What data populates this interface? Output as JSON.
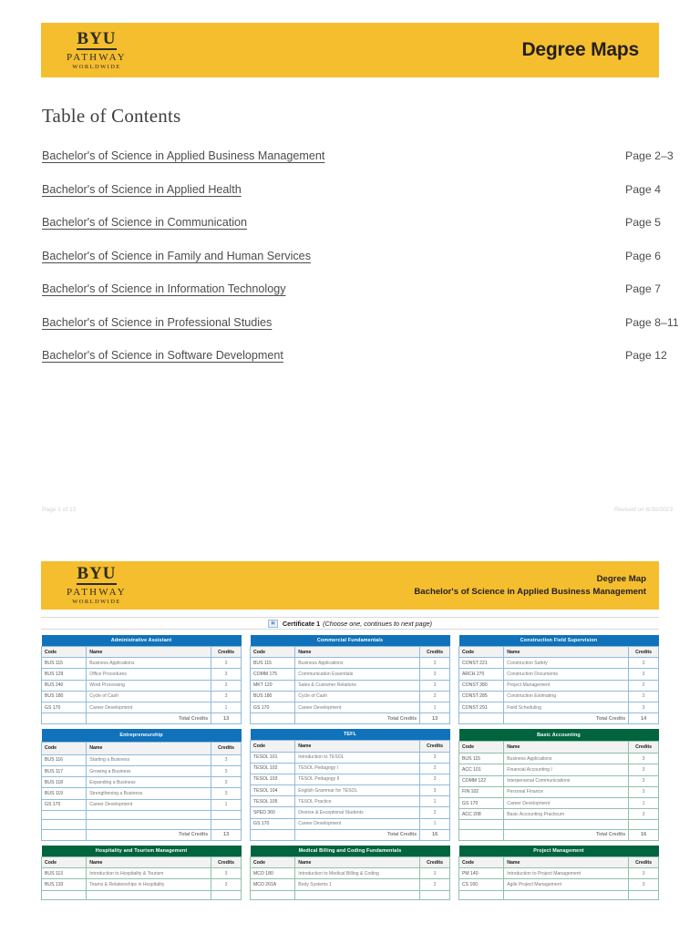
{
  "brand": {
    "logo_byu": "BYU",
    "logo_pathway": "PATHWAY",
    "logo_worldwide": "WORLDWIDE",
    "gold": "#F5BE2E",
    "blue": "#1072BA",
    "green": "#00653E"
  },
  "page1": {
    "band_title": "Degree Maps",
    "toc_heading": "Table of Contents",
    "entries": [
      {
        "label": "Bachelor's of Science in Applied Business Management",
        "page": "Page 2–3"
      },
      {
        "label": "Bachelor's of Science in Applied Health",
        "page": "Page 4"
      },
      {
        "label": "Bachelor's of Science in Communication",
        "page": "Page 5"
      },
      {
        "label": "Bachelor's of Science in Family and Human Services",
        "page": "Page 6"
      },
      {
        "label": "Bachelor's of Science in Information Technology",
        "page": "Page 7"
      },
      {
        "label": "Bachelor's of Science in Professional Studies",
        "page": "Page 8–11"
      },
      {
        "label": "Bachelor's of Science in Software Development",
        "page": "Page 12"
      }
    ],
    "footer_left": "Page 1 of 12",
    "footer_right": "Revised on 6/30/2023"
  },
  "page2": {
    "band_line1": "Degree Map",
    "band_line2": "Bachelor's of Science in Applied Business Management",
    "certificate_icon": "certificate-icon",
    "certificate_label": "Certificate 1",
    "certificate_note": "(Choose one, continues to next page)",
    "columns": {
      "code": "Code",
      "name": "Name",
      "credits": "Credits"
    },
    "total_label": "Total Credits",
    "tables": [
      {
        "title": "Administrative Assistant",
        "color": "blue",
        "rows": [
          {
            "code": "BUS 115",
            "name": "Business Applications",
            "credits": "3"
          },
          {
            "code": "BUS 129",
            "name": "Office Procedures",
            "credits": "3"
          },
          {
            "code": "BUS 240",
            "name": "Word Processing",
            "credits": "3"
          },
          {
            "code": "BUS 180",
            "name": "Cycle of Cash",
            "credits": "3"
          },
          {
            "code": "GS 170",
            "name": "Career Development",
            "credits": "1"
          }
        ],
        "total": "13"
      },
      {
        "title": "Commercial Fundamentals",
        "color": "blue",
        "rows": [
          {
            "code": "BUS 115",
            "name": "Business Applications",
            "credits": "3"
          },
          {
            "code": "COMM 175",
            "name": "Communication Essentials",
            "credits": "3"
          },
          {
            "code": "MKT 120",
            "name": "Sales & Customer Relations",
            "credits": "3"
          },
          {
            "code": "BUS 180",
            "name": "Cycle of Cash",
            "credits": "3"
          },
          {
            "code": "GS 170",
            "name": "Career Development",
            "credits": "1"
          }
        ],
        "total": "13"
      },
      {
        "title": "Construction Field Supervision",
        "color": "blue",
        "rows": [
          {
            "code": "CONST 221",
            "name": "Construction Safety",
            "credits": "3"
          },
          {
            "code": "ARCH 270",
            "name": "Construction Documents",
            "credits": "3"
          },
          {
            "code": "CONST 380",
            "name": "Project Management",
            "credits": "2"
          },
          {
            "code": "CONST 285",
            "name": "Construction Estimating",
            "credits": "3"
          },
          {
            "code": "CONST 291",
            "name": "Field Scheduling",
            "credits": "3"
          }
        ],
        "total": "14"
      },
      {
        "title": "Entrepreneurship",
        "color": "blue",
        "rows": [
          {
            "code": "BUS 116",
            "name": "Starting a Business",
            "credits": "3"
          },
          {
            "code": "BUS 117",
            "name": "Growing a Business",
            "credits": "3"
          },
          {
            "code": "BUS 118",
            "name": "Expanding a Business",
            "credits": "3"
          },
          {
            "code": "BUS 119",
            "name": "Strengthening a Business",
            "credits": "3"
          },
          {
            "code": "GS 170",
            "name": "Career Development",
            "credits": "1"
          },
          {
            "code": "",
            "name": "",
            "credits": ""
          },
          {
            "code": "",
            "name": "",
            "credits": ""
          }
        ],
        "total": "13"
      },
      {
        "title": "TEFL",
        "color": "blue",
        "rows": [
          {
            "code": "TESOL 101",
            "name": "Introduction to TESOL",
            "credits": "3"
          },
          {
            "code": "TESOL 102",
            "name": "TESOL Pedagogy I",
            "credits": "3"
          },
          {
            "code": "TESOL 103",
            "name": "TESOL Pedagogy II",
            "credits": "3"
          },
          {
            "code": "TESOL 104",
            "name": "English Grammar for TESOL",
            "credits": "3"
          },
          {
            "code": "TESOL 105",
            "name": "TESOL Practice",
            "credits": "1"
          },
          {
            "code": "SPED 360",
            "name": "Diverse & Exceptional Students",
            "credits": "2"
          },
          {
            "code": "GS 170",
            "name": "Career Development",
            "credits": "1"
          }
        ],
        "total": "16"
      },
      {
        "title": "Basic Accounting",
        "color": "green",
        "rows": [
          {
            "code": "BUS 115",
            "name": "Business Applications",
            "credits": "3"
          },
          {
            "code": "ACC 101",
            "name": "Financial Accounting I",
            "credits": "3"
          },
          {
            "code": "COMM 122",
            "name": "Interpersonal Communications",
            "credits": "3"
          },
          {
            "code": "FIN 102",
            "name": "Personal Finance",
            "credits": "3"
          },
          {
            "code": "GS 170",
            "name": "Career Development",
            "credits": "1"
          },
          {
            "code": "ACC 208",
            "name": "Basic Accounting Practicum",
            "credits": "3"
          },
          {
            "code": "",
            "name": "",
            "credits": ""
          }
        ],
        "total": "16"
      },
      {
        "title": "Hospitality and Tourism Management",
        "color": "green",
        "rows": [
          {
            "code": "BUS 113",
            "name": "Introduction to Hospitality & Tourism",
            "credits": "3"
          },
          {
            "code": "BUS 133",
            "name": "Teams & Relationships in Hospitality",
            "credits": "3"
          },
          {
            "code": "",
            "name": "",
            "credits": ""
          }
        ],
        "total": ""
      },
      {
        "title": "Medical Billing and Coding Fundamentals",
        "color": "green",
        "rows": [
          {
            "code": "MCO 180",
            "name": "Introduction to Medical Billing & Coding",
            "credits": "3"
          },
          {
            "code": "MCO 201A",
            "name": "Body Systems 1",
            "credits": "2"
          },
          {
            "code": "",
            "name": "",
            "credits": ""
          }
        ],
        "total": ""
      },
      {
        "title": "Project Management",
        "color": "green",
        "rows": [
          {
            "code": "PM 140",
            "name": "Introduction to Project Management",
            "credits": "3"
          },
          {
            "code": "CS 160",
            "name": "Agile Project Management",
            "credits": "3"
          },
          {
            "code": "",
            "name": "",
            "credits": ""
          }
        ],
        "total": ""
      }
    ]
  }
}
